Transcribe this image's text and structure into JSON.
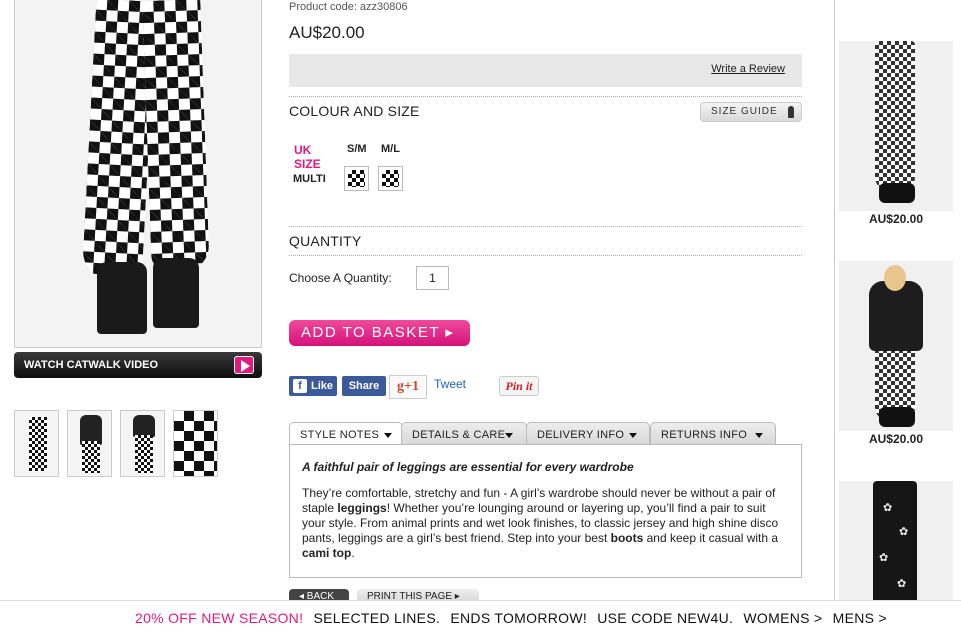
{
  "product": {
    "code": "Product code: azz30806",
    "price": "AU$20.00",
    "write_review": "Write a Review",
    "catwalk_label": "WATCH CATWALK VIDEO"
  },
  "colour_size": {
    "title": "COLOUR AND SIZE",
    "size_guide": "SIZE GUIDE",
    "size_label": "UK SIZE",
    "sizes": [
      "S/M",
      "M/L"
    ],
    "colour": "MULTI"
  },
  "quantity": {
    "title": "QUANTITY",
    "label": "Choose A Quantity:",
    "value": "1"
  },
  "basket_button": "ADD TO BASKET ▸",
  "social": {
    "like": "Like",
    "share": "Share",
    "gplus": "+1",
    "tweet": "Tweet",
    "pinit": "Pin it"
  },
  "tabs": [
    {
      "label": "STYLE NOTES"
    },
    {
      "label": "DETAILS & CARE"
    },
    {
      "label": "DELIVERY INFO"
    },
    {
      "label": "RETURNS INFO"
    }
  ],
  "style_notes": {
    "heading": "A faithful pair of leggings are essential for every wardrobe",
    "p1": "They’re comfortable, stretchy and fun - A girl’s wardrobe should never be without a pair of staple ",
    "b1": "leggings",
    "p2": "! Whether you’re lounging around or layering up, you’ll find a pair to suit your style. From animal prints and wet look finishes, to classic jersey and high shine disco pants, leggings are a girl’s best friend. Step into your best ",
    "b2": "boots",
    "p3": " and keep it casual with a ",
    "b3": "cami top",
    "p4": "."
  },
  "nav_buttons": {
    "back": "◂ BACK",
    "print": "PRINT THIS PAGE ▸"
  },
  "related": [
    {
      "price": "AU$20.00"
    },
    {
      "price": "AU$20.00"
    }
  ],
  "promo": {
    "highlight": "20% OFF NEW SEASON!",
    "text1": "SELECTED LINES.",
    "text2": "ENDS TOMORROW!",
    "text3": "USE CODE NEW4U.",
    "link1": "WOMENS >",
    "link2": "MENS >"
  },
  "colors": {
    "accent": "#e4197f",
    "facebook": "#3b5a9a"
  }
}
